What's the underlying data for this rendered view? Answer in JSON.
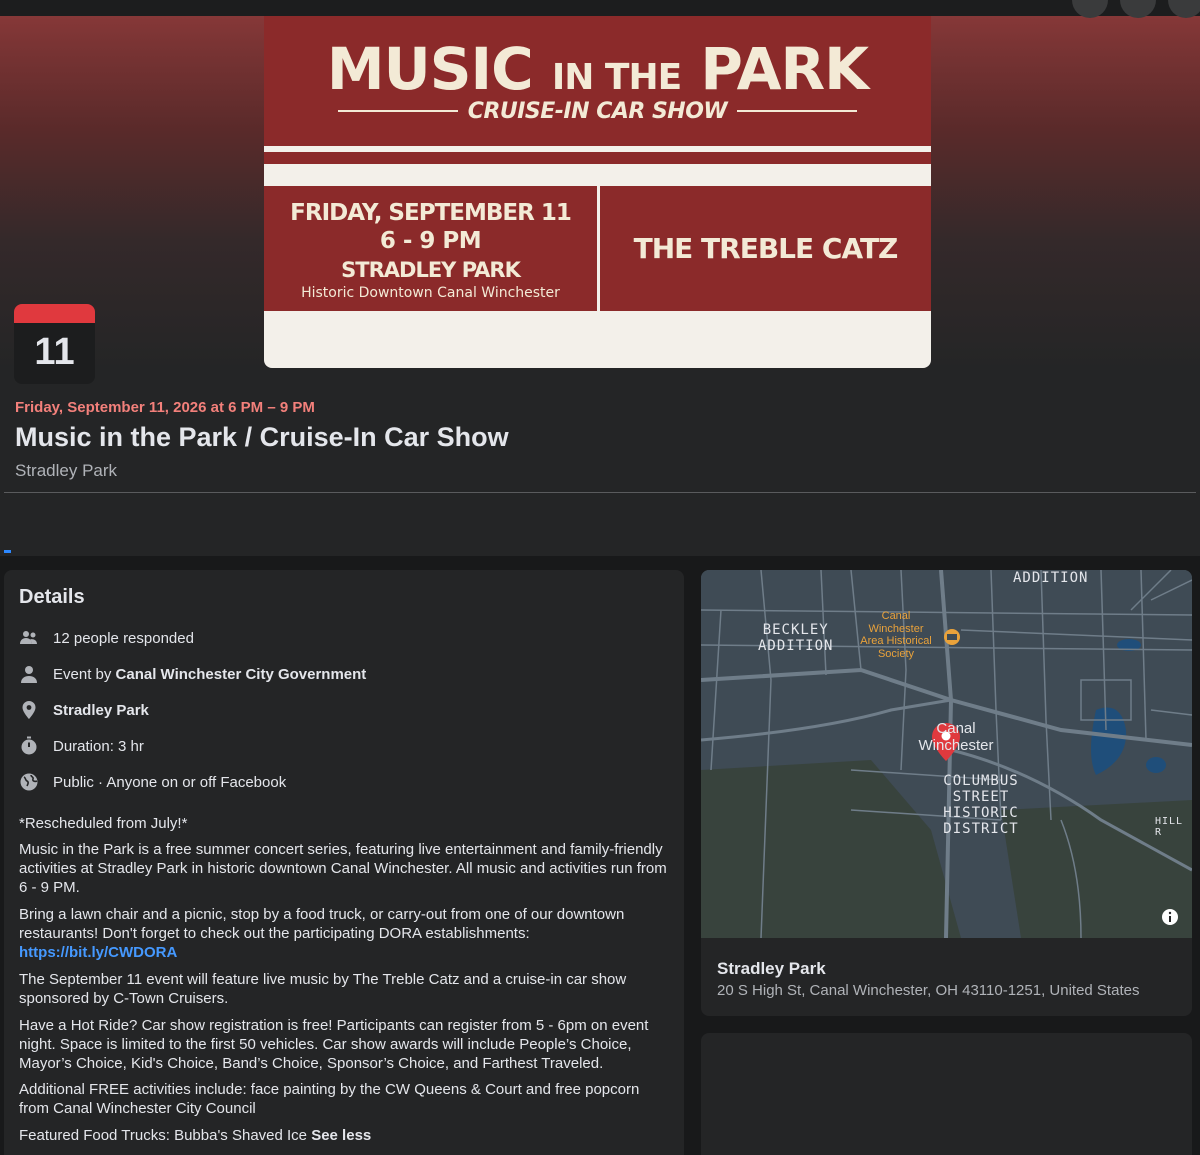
{
  "cover": {
    "title_big1": "MUSIC",
    "title_small": "IN THE",
    "title_big2": "PARK",
    "subtitle": "CRUISE-IN CAR SHOW",
    "date": "FRIDAY, SEPTEMBER 11",
    "time": "6 - 9 PM",
    "venue": "STRADLEY PARK",
    "venue_sub": "Historic Downtown Canal Winchester",
    "band": "THE TREBLE CATZ"
  },
  "calendar": {
    "day": "11"
  },
  "event": {
    "date_line": "Friday, September 11, 2026 at 6 PM – 9 PM",
    "title": "Music in the Park / Cruise-In Car Show",
    "place": "Stradley Park"
  },
  "details": {
    "heading": "Details",
    "responded": "12 people responded",
    "event_by_prefix": "Event by ",
    "event_by_org": "Canal Winchester City Government",
    "location": "Stradley Park",
    "duration": "Duration: 3 hr",
    "privacy": "Public · Anyone on or off Facebook",
    "p1": "*Rescheduled from July!*",
    "p2": "Music in the Park is a free summer concert series, featuring live entertainment and family-friendly activities at Stradley Park in historic downtown Canal Winchester. All music and activities run from 6 - 9 PM.",
    "p3": "Bring a lawn chair and a picnic, stop by a food truck, or carry-out from one of our downtown restaurants! Don't forget to check out the participating DORA establishments:",
    "p3_link": "https://bit.ly/CWDORA",
    "p4": "The September 11 event will feature live music by The Treble Catz and a cruise-in car show sponsored by C-Town Cruisers.",
    "p5": "Have a Hot Ride? Car show registration is free! Participants can register from 5 - 6pm on event night. Space is limited to the first 50 vehicles. Car show awards will include People’s Choice, Mayor’s Choice, Kid's Choice, Band’s Choice, Sponsor’s Choice, and Farthest Traveled.",
    "p6": "Additional FREE activities include: face painting by the CW Queens & Court and free popcorn from Canal Winchester City Council",
    "p7": "Featured Food Trucks: Bubba's Shaved Ice ",
    "see_less": "See less"
  },
  "map": {
    "label_addition": "ADDITION",
    "label_beckley_1": "BECKLEY",
    "label_beckley_2": "ADDITION",
    "label_society_1": "Canal",
    "label_society_2": "Winchester",
    "label_society_3": "Area Historical",
    "label_society_4": "Society",
    "label_town_1": "Canal",
    "label_town_2": "Winchester",
    "label_district_1": "COLUMBUS",
    "label_district_2": "STREET",
    "label_district_3": "HISTORIC",
    "label_district_4": "DISTRICT",
    "label_hill": "HILL R",
    "place_name": "Stradley Park",
    "address": "20 S High St, Canal Winchester, OH 43110-1251, United States"
  },
  "colors": {
    "cover_red": "#8b2a2a",
    "date_accent": "#f3807b",
    "link": "#4599ff",
    "pin": "#e0393e"
  }
}
